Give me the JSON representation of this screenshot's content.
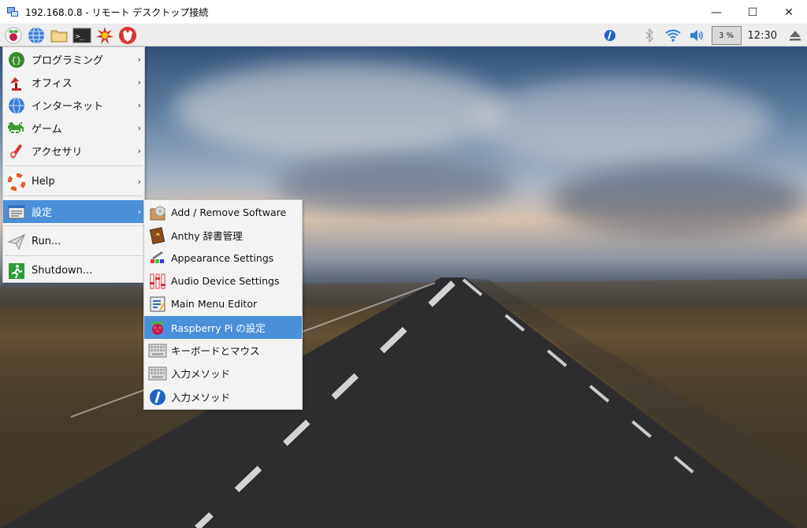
{
  "window": {
    "title": "192.168.0.8 - リモート デスクトップ接続",
    "minimize": "—",
    "maximize": "☐",
    "close": "✕"
  },
  "tray": {
    "cpu": "3 %",
    "clock": "12:30"
  },
  "menu": {
    "items": [
      {
        "label": "プログラミング",
        "arrow": "›"
      },
      {
        "label": "オフィス",
        "arrow": "›"
      },
      {
        "label": "インターネット",
        "arrow": "›"
      },
      {
        "label": "ゲーム",
        "arrow": "›"
      },
      {
        "label": "アクセサリ",
        "arrow": "›"
      },
      {
        "label": "Help",
        "arrow": "›"
      },
      {
        "label": "設定",
        "arrow": "›"
      },
      {
        "label": "Run..."
      },
      {
        "label": "Shutdown..."
      }
    ]
  },
  "submenu": {
    "items": [
      {
        "label": "Add / Remove Software"
      },
      {
        "label": "Anthy 辞書管理"
      },
      {
        "label": "Appearance Settings"
      },
      {
        "label": "Audio Device Settings"
      },
      {
        "label": "Main Menu Editor"
      },
      {
        "label": "Raspberry Pi の設定"
      },
      {
        "label": "キーボードとマウス"
      },
      {
        "label": "入力メソッド"
      },
      {
        "label": "入力メソッド"
      }
    ]
  },
  "colors": {
    "selection": "#4a90d9",
    "menu_bg": "#f3f3f3",
    "taskbar_bg": "#ededed"
  }
}
